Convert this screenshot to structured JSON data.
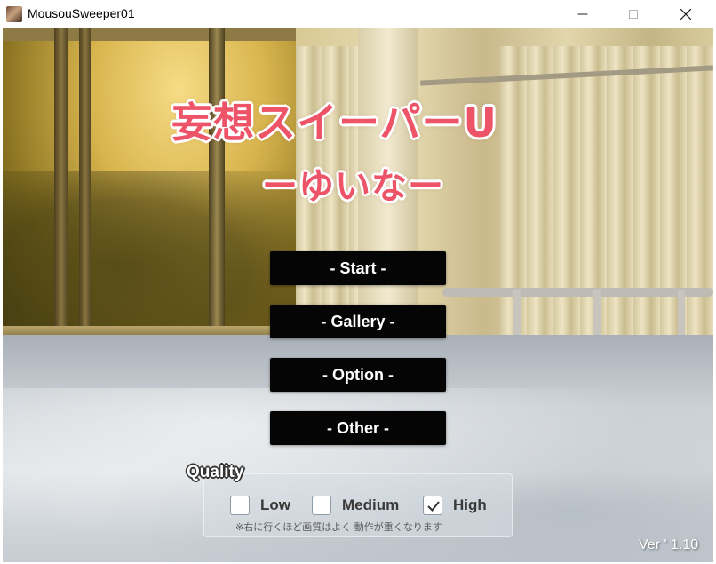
{
  "window": {
    "title": "MousouSweeper01",
    "app_icon": "character-portrait-icon",
    "controls": [
      "minimize-icon",
      "maximize-icon",
      "close-icon"
    ]
  },
  "logo": {
    "title_line1": "妄想スイーパーU",
    "title_line2": "ーゆいなー",
    "color": "#ee5468"
  },
  "menu": {
    "start": "- Start -",
    "gallery": "- Gallery -",
    "option": "- Option -",
    "other": "- Other -"
  },
  "quality": {
    "label": "Quality",
    "options": [
      {
        "label": "Low",
        "checked": false
      },
      {
        "label": "Medium",
        "checked": false
      },
      {
        "label": "High",
        "checked": true
      }
    ],
    "note": "※右に行くほど画質はよく 動作が重くなります"
  },
  "version": "Ver ' 1.10"
}
